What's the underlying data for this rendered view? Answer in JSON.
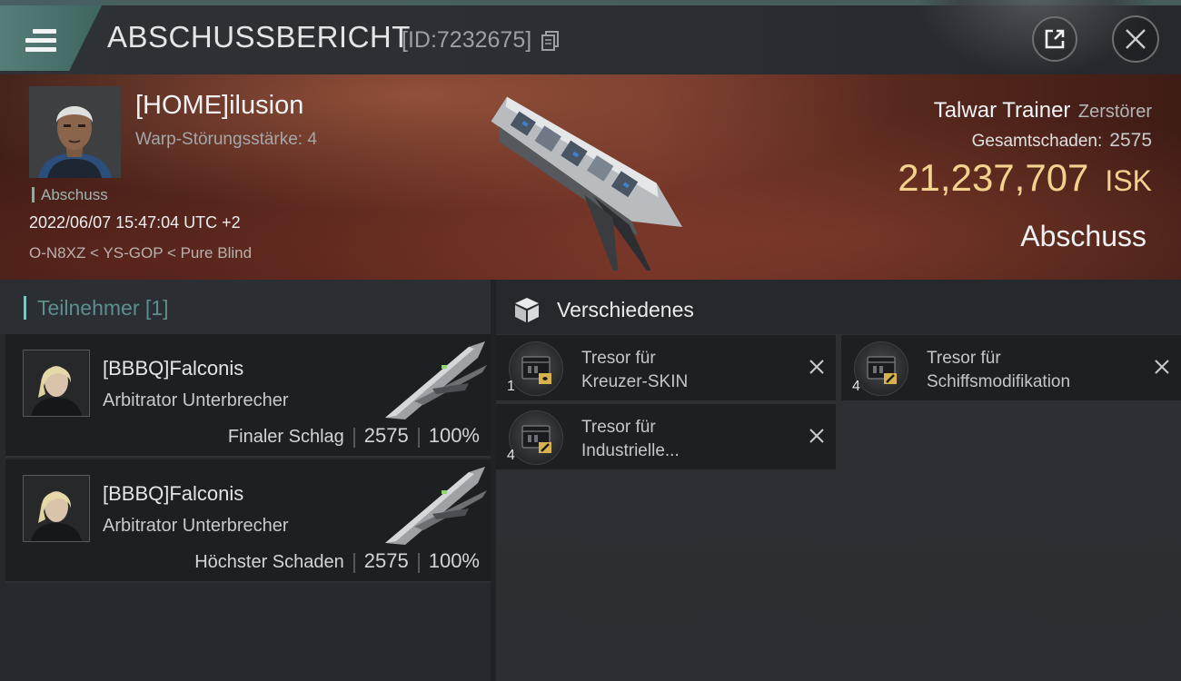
{
  "header": {
    "title": "ABSCHUSSBERICHT",
    "report_id": "[ID:7232675]",
    "icons": [
      "menu-icon",
      "copy-icon",
      "share-icon",
      "close-icon"
    ]
  },
  "victim": {
    "name": "[HOME]ilusion",
    "warp_strength": "Warp-Störungsstärke: 4",
    "tag": "Abschuss",
    "timestamp": "2022/06/07 15:47:04 UTC +2",
    "location": "O-N8XZ < YS-GOP < Pure Blind",
    "ship_name": "Talwar Trainer",
    "ship_class": "Zerstörer",
    "damage_label": "Gesamtschaden:",
    "damage_value": "2575",
    "isk_value": "21,237,707",
    "isk_unit": "ISK",
    "kill_type": "Abschuss"
  },
  "participants_panel": {
    "title": "Teilnehmer [1]",
    "items": [
      {
        "name": "[BBBQ]Falconis",
        "ship": "Arbitrator Unterbrecher",
        "role": "Finaler Schlag",
        "damage": "2575",
        "percent": "100%"
      },
      {
        "name": "[BBBQ]Falconis",
        "ship": "Arbitrator Unterbrecher",
        "role": "Höchster Schaden",
        "damage": "2575",
        "percent": "100%"
      }
    ]
  },
  "misc_panel": {
    "title": "Verschiedenes",
    "items": [
      {
        "name_line1": "Tresor für",
        "name_line2": "Kreuzer-SKIN",
        "qty": "1"
      },
      {
        "name_line1": "Tresor für",
        "name_line2": "Schiffsmodifikation",
        "qty": "4"
      },
      {
        "name_line1": "Tresor für",
        "name_line2": "Industrielle...",
        "qty": "4"
      }
    ]
  },
  "colors": {
    "accent_teal": "#7fc4c0",
    "isk_gold": "#f2d28e",
    "menu_tab": "#567d78"
  }
}
